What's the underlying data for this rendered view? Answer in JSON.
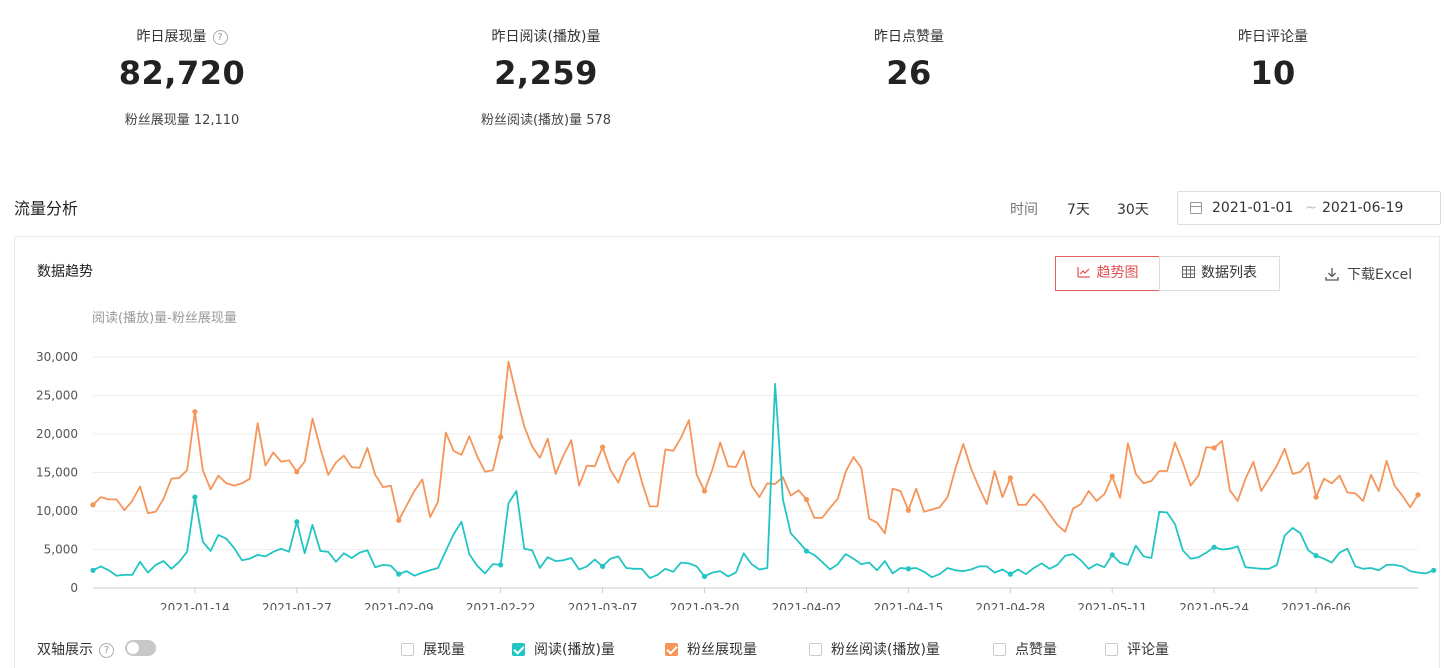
{
  "stats": [
    {
      "label": "昨日展现量",
      "value": "82,720",
      "sub": "粉丝展现量 12,110",
      "help": "?"
    },
    {
      "label": "昨日阅读(播放)量",
      "value": "2,259",
      "sub": "粉丝阅读(播放)量 578"
    },
    {
      "label": "昨日点赞量",
      "value": "26",
      "sub": ""
    },
    {
      "label": "昨日评论量",
      "value": "10",
      "sub": ""
    }
  ],
  "traffic": {
    "title": "流量分析",
    "time_label": "时间",
    "range_7": "7天",
    "range_30": "30天",
    "date_start": "2021-01-01",
    "date_sep": "~",
    "date_end": "2021-06-19"
  },
  "panel": {
    "title": "数据趋势",
    "trend_btn": "趋势图",
    "table_btn": "数据列表",
    "download": "下载Excel",
    "accent": "#e05050",
    "dual_axis": "双轴展示",
    "dual_help": "?"
  },
  "legend": [
    {
      "label": "展现量",
      "checked": false,
      "color": "#cccccc"
    },
    {
      "label": "阅读(播放)量",
      "checked": true,
      "color": "#23c4c4"
    },
    {
      "label": "粉丝展现量",
      "checked": true,
      "color": "#f5955a"
    },
    {
      "label": "粉丝阅读(播放)量",
      "checked": false,
      "color": "#cccccc"
    },
    {
      "label": "点赞量",
      "checked": false,
      "color": "#cccccc"
    },
    {
      "label": "评论量",
      "checked": false,
      "color": "#cccccc"
    }
  ],
  "chart_data": {
    "type": "line",
    "title": "阅读(播放)量-粉丝展现量",
    "ylim": [
      0,
      30000
    ],
    "y_ticks": [
      0,
      5000,
      10000,
      15000,
      20000,
      25000,
      30000
    ],
    "y_tick_labels": [
      "0",
      "5,000",
      "10,000",
      "15,000",
      "20,000",
      "25,000",
      "30,000"
    ],
    "x_tick_labels": [
      "2021-01-14",
      "2021-01-27",
      "2021-02-09",
      "2021-02-22",
      "2021-03-07",
      "2021-03-20",
      "2021-04-02",
      "2021-04-15",
      "2021-04-28",
      "2021-05-11",
      "2021-05-24",
      "2021-06-06"
    ],
    "x_tick_positions": [
      13,
      26,
      39,
      52,
      65,
      78,
      91,
      104,
      117,
      130,
      143,
      156
    ],
    "x_count": 170,
    "grid": true,
    "legend": "bottom",
    "series": [
      {
        "name": "粉丝展现量",
        "color": "#f5955a",
        "values": [
          10800,
          11800,
          11500,
          11500,
          10100,
          11300,
          13200,
          9700,
          9900,
          11600,
          14200,
          14300,
          15300,
          22900,
          15300,
          12800,
          14600,
          13600,
          13300,
          13600,
          14200,
          21400,
          15900,
          17600,
          16400,
          16600,
          15100,
          16400,
          22000,
          18100,
          14700,
          16300,
          17200,
          15700,
          15600,
          18200,
          14700,
          13100,
          13300,
          8800,
          10700,
          12600,
          14100,
          9200,
          11200,
          20200,
          17800,
          17300,
          19700,
          17100,
          15100,
          15300,
          19600,
          29400,
          25000,
          21000,
          18400,
          16900,
          19400,
          14800,
          17200,
          19200,
          13300,
          15900,
          15800,
          18300,
          15300,
          13700,
          16400,
          17600,
          13800,
          10600,
          10600,
          18000,
          17800,
          19500,
          21800,
          14700,
          12600,
          15400,
          18900,
          15800,
          15700,
          17800,
          13300,
          11800,
          13600,
          13500,
          14400,
          12000,
          12700,
          11500,
          9100,
          9100,
          10400,
          11600,
          15100,
          17000,
          15600,
          9000,
          8500,
          7100,
          12900,
          12600,
          10100,
          12900,
          9900,
          10200,
          10500,
          11800,
          15500,
          18700,
          15500,
          13100,
          10900,
          15200,
          11800,
          14300,
          10800,
          10800,
          12200,
          11100,
          9600,
          8200,
          7300,
          10300,
          10900,
          12600,
          11300,
          12200,
          14500,
          11700,
          18800,
          14800,
          13600,
          13900,
          15200,
          15200,
          18900,
          16300,
          13300,
          14600,
          18300,
          18200,
          19100,
          12700,
          11300,
          14200,
          16400,
          12600,
          14200,
          15900,
          18100,
          14800,
          15100,
          16300,
          11800,
          14200,
          13600,
          14600,
          12400,
          12300,
          11300,
          14700,
          12600,
          16500,
          13300,
          12000,
          10500,
          12100
        ]
      },
      {
        "name": "阅读(播放)量",
        "color": "#23c4c4",
        "values": [
          2300,
          2800,
          2300,
          1600,
          1700,
          1700,
          3400,
          2000,
          3000,
          3500,
          2500,
          3400,
          4700,
          11800,
          6000,
          4800,
          6900,
          6400,
          5200,
          3600,
          3800,
          4300,
          4100,
          4700,
          5100,
          4700,
          8600,
          4500,
          8200,
          4800,
          4700,
          3400,
          4500,
          3900,
          4600,
          4900,
          2700,
          3000,
          2900,
          1800,
          2200,
          1600,
          2000,
          2300,
          2600,
          4800,
          7000,
          8600,
          4400,
          2900,
          1900,
          3100,
          3000,
          11000,
          12600,
          5100,
          4900,
          2600,
          4000,
          3500,
          3600,
          3900,
          2400,
          2800,
          3700,
          2800,
          3800,
          4100,
          2600,
          2500,
          2500,
          1300,
          1700,
          2500,
          2100,
          3300,
          3200,
          2800,
          1500,
          2000,
          2200,
          1500,
          2000,
          4500,
          3100,
          2400,
          2600,
          26500,
          11500,
          7100,
          6000,
          4800,
          4300,
          3400,
          2400,
          3100,
          4400,
          3800,
          3100,
          3300,
          2300,
          3500,
          1900,
          2600,
          2500,
          2600,
          2100,
          1400,
          1800,
          2600,
          2300,
          2200,
          2400,
          2800,
          2800,
          2000,
          2400,
          1800,
          2400,
          1800,
          2600,
          3200,
          2500,
          3000,
          4200,
          4400,
          3600,
          2500,
          3100,
          2700,
          4300,
          3300,
          3000,
          5500,
          4100,
          3900,
          9900,
          9800,
          8300,
          4900,
          3800,
          4000,
          4600,
          5300,
          5000,
          5100,
          5400,
          2700,
          2600,
          2500,
          2500,
          3000,
          6800,
          7800,
          7100,
          4900,
          4200,
          3800,
          3300,
          4600,
          5100,
          2800,
          2500,
          2600,
          2300,
          3000,
          3000,
          2800,
          2200,
          2000,
          1900,
          2300
        ]
      }
    ]
  }
}
